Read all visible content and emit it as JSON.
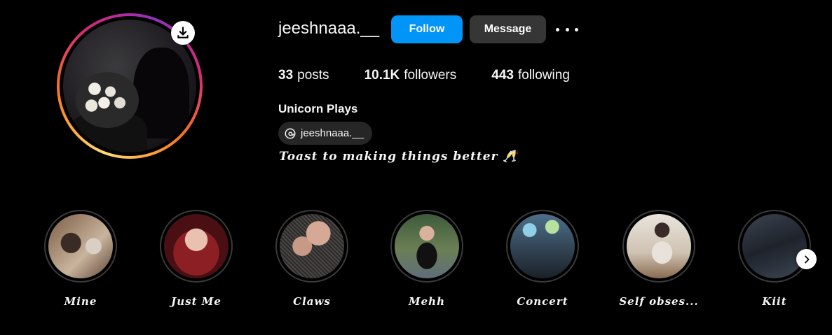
{
  "profile": {
    "username": "jeeshnaaa.__",
    "full_name": "Unicorn Plays",
    "threads_handle": "jeeshnaaa.__",
    "bio": "Toast to making things better 🥂",
    "follow_label": "Follow",
    "message_label": "Message"
  },
  "stats": {
    "posts_count": "33",
    "posts_label": "posts",
    "followers_count": "10.1K",
    "followers_label": "followers",
    "following_count": "443",
    "following_label": "following"
  },
  "highlights": [
    {
      "label": "Mine"
    },
    {
      "label": "Just Me"
    },
    {
      "label": "Claws"
    },
    {
      "label": "Mehh"
    },
    {
      "label": "Concert"
    },
    {
      "label": "Self obses..."
    },
    {
      "label": "Kiit"
    }
  ],
  "icons": {
    "download": "download-icon",
    "more": "more-options-icon",
    "threads": "threads-icon",
    "next": "chevron-right-icon"
  },
  "colors": {
    "follow_button": "#0095f6",
    "message_button": "#363636",
    "background": "#000000"
  }
}
